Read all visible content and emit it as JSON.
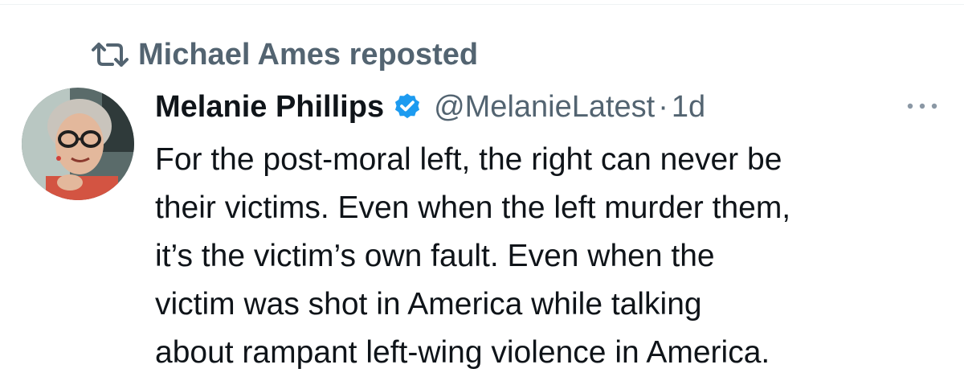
{
  "repost": {
    "icon": "repost-icon",
    "label": "Michael Ames reposted"
  },
  "tweet": {
    "author": {
      "display_name": "Melanie Phillips",
      "verified": true,
      "verified_icon": "verified-badge-icon",
      "verified_color": "#1d9bf0",
      "handle": "@MelanieLatest",
      "separator": "·",
      "timestamp": "1d",
      "avatar": "author-avatar"
    },
    "more_icon": "more-options-icon",
    "text_lines": [
      "For the post-moral left, the right can never be",
      "their victims. Even when the left murder them,",
      "it’s the victim’s own fault. Even when the",
      "victim was shot in America while talking",
      "about rampant left-wing violence in America."
    ]
  },
  "colors": {
    "text_primary": "#0f1419",
    "text_secondary": "#536471",
    "accent": "#1d9bf0",
    "background": "#ffffff"
  }
}
